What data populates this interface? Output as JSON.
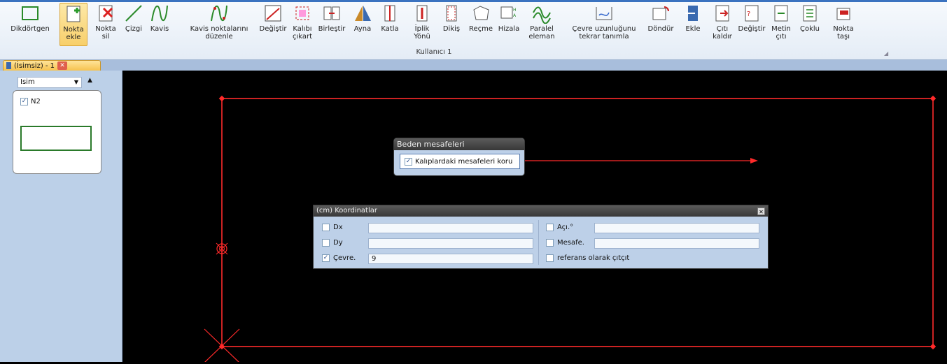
{
  "ribbon": {
    "group_label": "Kullanıcı 1",
    "tools": [
      {
        "id": "dikdortgen",
        "label": "Dikdörtgen",
        "icon": "rectangle-icon"
      },
      {
        "id": "nokta-ekle",
        "label": "Nokta\nekle",
        "icon": "add-point-icon",
        "active": true
      },
      {
        "id": "nokta-sil",
        "label": "Nokta\nsil",
        "icon": "delete-point-icon"
      },
      {
        "id": "cizgi",
        "label": "Çizgi",
        "icon": "line-icon"
      },
      {
        "id": "kavis",
        "label": "Kavis",
        "icon": "curve-icon"
      },
      {
        "id": "kavis-duzenle",
        "label": "Kavis noktalarını\ndüzenle",
        "icon": "edit-curve-points-icon"
      },
      {
        "id": "degistir",
        "label": "Değiştir",
        "icon": "modify-icon"
      },
      {
        "id": "kalibi-cikart",
        "label": "Kalıbı\nçıkart",
        "icon": "extract-pattern-icon"
      },
      {
        "id": "birlestir",
        "label": "Birleştir",
        "icon": "merge-icon"
      },
      {
        "id": "ayna",
        "label": "Ayna",
        "icon": "mirror-icon"
      },
      {
        "id": "katla",
        "label": "Katla",
        "icon": "fold-icon"
      },
      {
        "id": "iplik-yonu",
        "label": "İplik\nYönü",
        "icon": "grain-line-icon"
      },
      {
        "id": "dikis",
        "label": "Dikiş",
        "icon": "seam-icon"
      },
      {
        "id": "recme",
        "label": "Reçme",
        "icon": "ease-icon"
      },
      {
        "id": "hizala",
        "label": "Hizala",
        "icon": "align-icon"
      },
      {
        "id": "paralel-eleman",
        "label": "Paralel\neleman",
        "icon": "parallel-icon"
      },
      {
        "id": "cevre-uzunlugu",
        "label": "Çevre uzunluğunu\ntekrar tanımla",
        "icon": "perimeter-icon"
      },
      {
        "id": "dondur",
        "label": "Döndür",
        "icon": "rotate-icon"
      },
      {
        "id": "ekle",
        "label": "Ekle",
        "icon": "insert-icon"
      },
      {
        "id": "citi-kaldir",
        "label": "Çıtı\nkaldır",
        "icon": "remove-notch-icon"
      },
      {
        "id": "degistir2",
        "label": "Değiştir",
        "icon": "change-notch-icon"
      },
      {
        "id": "metin-citi",
        "label": "Metin\nçıtı",
        "icon": "text-notch-icon"
      },
      {
        "id": "coklu",
        "label": "Çoklu",
        "icon": "multi-notch-icon"
      },
      {
        "id": "nokta-tasi",
        "label": "Nokta\ntaşı",
        "icon": "move-point-icon"
      }
    ]
  },
  "tab": {
    "label": "(İsimsiz) - 1"
  },
  "panel": {
    "sort_value": "Isim",
    "piece_name": "N2",
    "piece_checked": true
  },
  "beden": {
    "title": "Beden mesafeleri",
    "option_label": "Kalıplardaki mesafeleri koru",
    "option_checked": true
  },
  "koord": {
    "title": "(cm) Koordinatlar",
    "dx_label": "Dx",
    "dx_value": "",
    "dy_label": "Dy",
    "dy_value": "",
    "cevre_label": "Çevre.",
    "cevre_value": "9",
    "cevre_checked": true,
    "aci_label": "Açı.°",
    "aci_value": "",
    "mesafe_label": "Mesafe.",
    "mesafe_value": "",
    "referans_label": "referans olarak çıtçıt"
  },
  "colors": {
    "accent": "#ff2a2a",
    "canvas_bg": "#000000"
  }
}
